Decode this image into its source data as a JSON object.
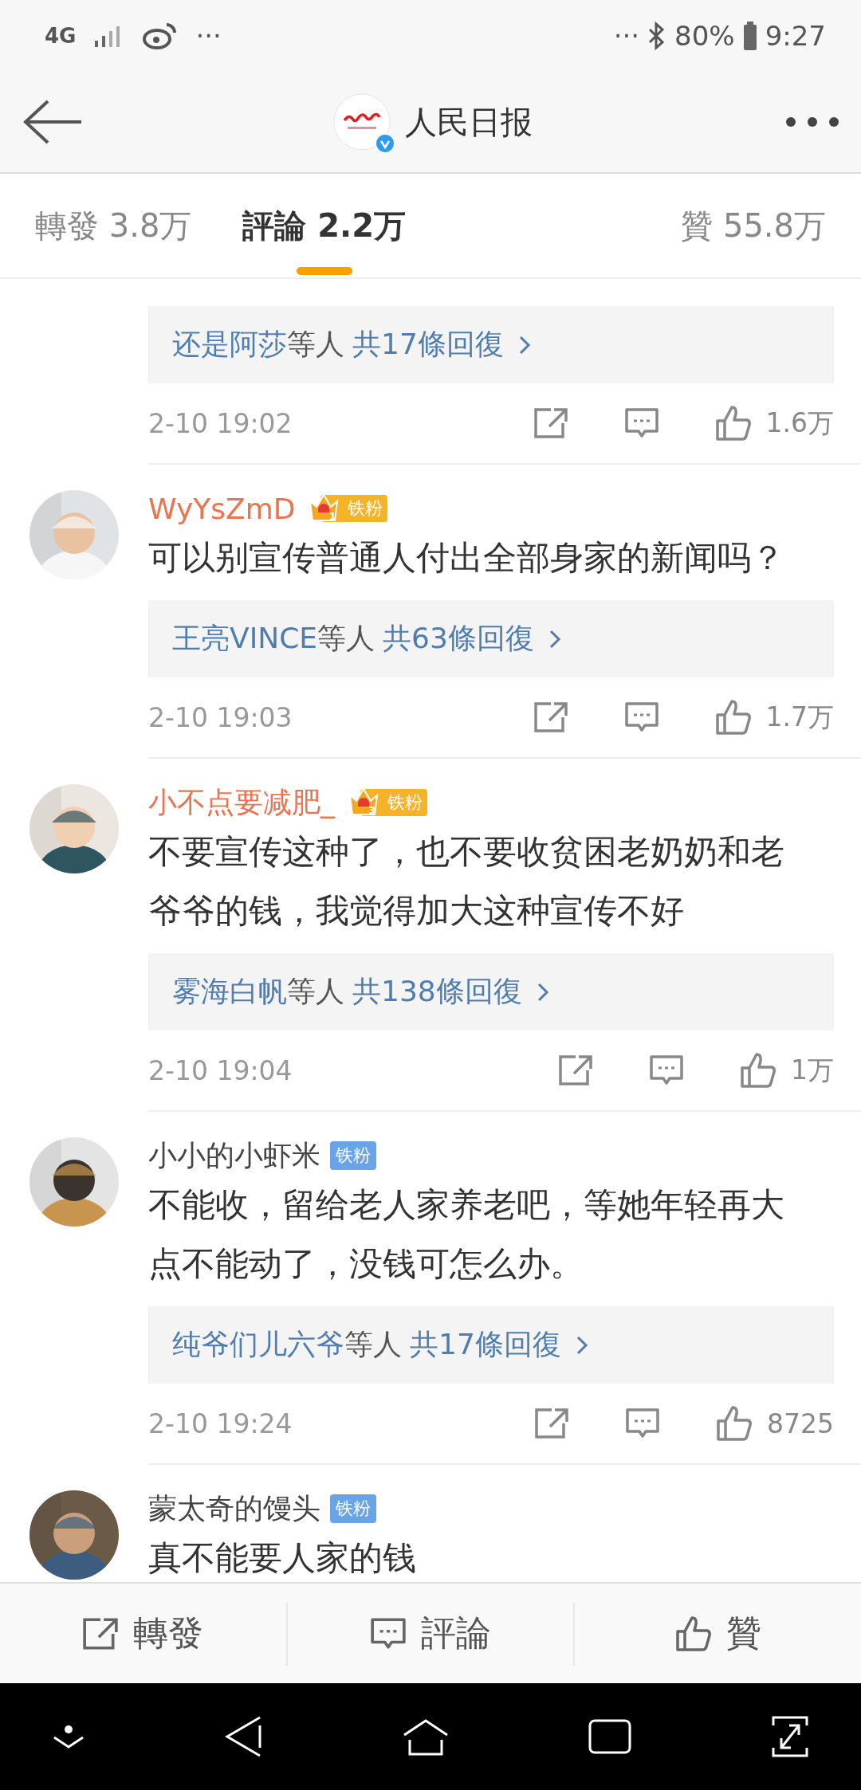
{
  "status_bar": {
    "network": "4G",
    "left_more": "···",
    "right_more": "···",
    "battery": "80%",
    "time": "9:27"
  },
  "header": {
    "title": "人民日报",
    "verified": true
  },
  "tabs": [
    {
      "label": "轉發",
      "count": "3.8万",
      "selected": false
    },
    {
      "label": "評論",
      "count": "2.2万",
      "selected": true
    },
    {
      "label": "贊",
      "count": "55.8万",
      "selected": false
    }
  ],
  "comments": [
    {
      "replies": {
        "users": "还是阿莎",
        "joiner": "等人",
        "total": "共17條回復"
      },
      "time": "2-10 19:02",
      "likes": "1.6万"
    },
    {
      "name": "WyYsZmD",
      "vip": true,
      "badge": {
        "kind": "crown",
        "level": "1",
        "label": "铁粉"
      },
      "text": "可以别宣传普通人付出全部身家的新闻吗？",
      "replies": {
        "users": "王亮VINCE",
        "joiner": "等人",
        "total": "共63條回復"
      },
      "time": "2-10 19:03",
      "likes": "1.7万"
    },
    {
      "name": "小不点要减肥_",
      "vip": true,
      "badge": {
        "kind": "crown",
        "level": "3",
        "label": "铁粉"
      },
      "text": "不要宣传这种了，也不要收贫困老奶奶和老爷爷的钱，我觉得加大这种宣传不好",
      "replies": {
        "users": "雾海白帆",
        "joiner": "等人",
        "total": "共138條回復"
      },
      "time": "2-10 19:04",
      "likes": "1万"
    },
    {
      "name": "小小的小虾米",
      "vip": false,
      "badge": {
        "kind": "plain",
        "label": "铁粉"
      },
      "text": "不能收，留给老人家养老吧，等她年轻再大点不能动了，没钱可怎么办。",
      "replies": {
        "users": "纯爷们儿六爷",
        "joiner": "等人",
        "total": "共17條回復"
      },
      "time": "2-10 19:24",
      "likes": "8725"
    },
    {
      "name": "蒙太奇的馒头",
      "vip": false,
      "badge": {
        "kind": "plain",
        "label": "铁粉"
      },
      "text": "真不能要人家的钱"
    }
  ],
  "actions": [
    {
      "kind": "repost",
      "label": "轉發"
    },
    {
      "kind": "comment",
      "label": "評論"
    },
    {
      "kind": "like",
      "label": "贊"
    }
  ]
}
